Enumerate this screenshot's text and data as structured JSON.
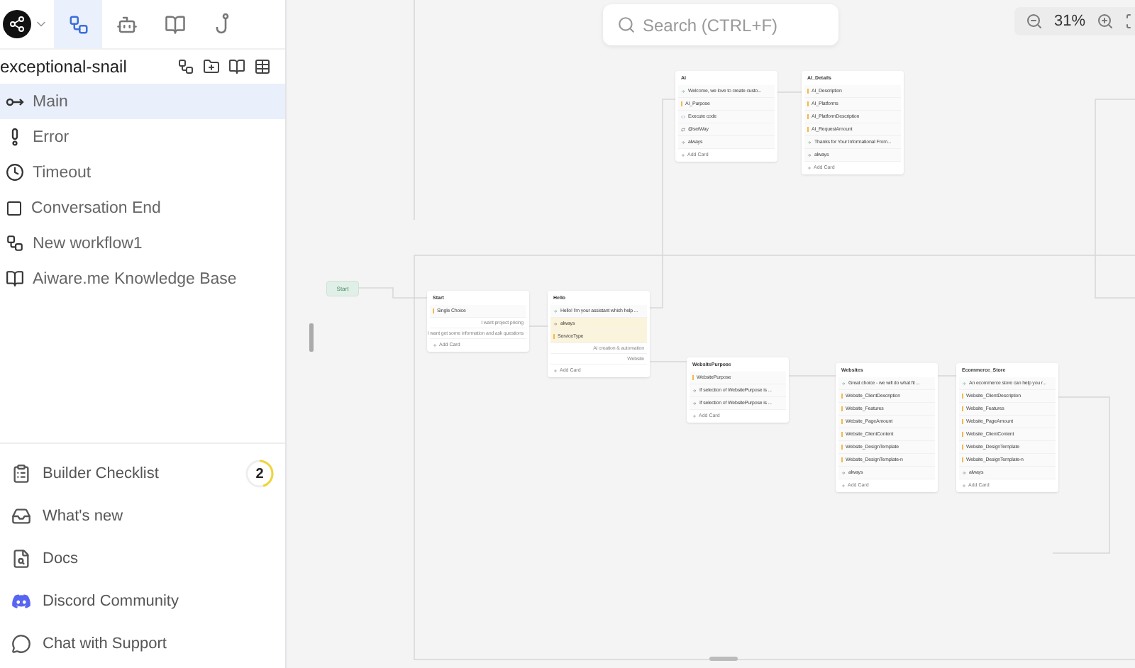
{
  "sidebar": {
    "tabs": [
      {
        "kind": "workflow",
        "selected": true
      },
      {
        "kind": "bot",
        "selected": false
      },
      {
        "kind": "book",
        "selected": false
      },
      {
        "kind": "hook",
        "selected": false
      }
    ]
  },
  "project": {
    "name": "exceptional-snail"
  },
  "workflows": [
    {
      "kind": "main",
      "label": "Main",
      "selected": true
    },
    {
      "kind": "error",
      "label": "Error",
      "selected": false
    },
    {
      "kind": "timeout",
      "label": "Timeout",
      "selected": false
    },
    {
      "kind": "end",
      "label": "Conversation End",
      "selected": false
    },
    {
      "kind": "workflow",
      "label": "New workflow1",
      "selected": false
    },
    {
      "kind": "knowledge",
      "label": "Aiware.me Knowledge Base",
      "selected": false
    }
  ],
  "footer_links": [
    {
      "kind": "checklist",
      "label": "Builder Checklist",
      "badge": "2",
      "level": 0.45
    },
    {
      "kind": "news",
      "label": "What's new"
    },
    {
      "kind": "docs",
      "label": "Docs"
    },
    {
      "kind": "discord",
      "label": "Discord Community"
    },
    {
      "kind": "support",
      "label": "Chat with Support"
    }
  ],
  "search": {
    "placeholder": "Search (CTRL+F)"
  },
  "zoom": {
    "value": "31%"
  },
  "canvas": {
    "start_label": "Start",
    "nodes": [
      {
        "title": "Start",
        "add_label": "Add Card",
        "rows": [
          {
            "kind": "input",
            "text": "Single Choice",
            "highlighted": false
          },
          {
            "kind": "option",
            "text": "I want project pricing",
            "highlighted": false
          },
          {
            "kind": "option",
            "text": "I want get some information and ask questions",
            "highlighted": false
          }
        ]
      },
      {
        "title": "Hello",
        "add_label": "Add Card",
        "rows": [
          {
            "kind": "message",
            "text": "Hello! I'm your assistant which help ...",
            "highlighted": false
          },
          {
            "kind": "always",
            "text": "always",
            "highlighted": true
          },
          {
            "kind": "input",
            "text": "ServiceType",
            "highlighted": true
          },
          {
            "kind": "option",
            "text": "AI creation & automation",
            "highlighted": false
          },
          {
            "kind": "option",
            "text": "Website",
            "highlighted": false
          }
        ]
      },
      {
        "title": "AI",
        "add_label": "Add Card",
        "rows": [
          {
            "kind": "message",
            "text": "Welcome, we love to create custo...",
            "highlighted": false
          },
          {
            "kind": "input",
            "text": "AI_Purpose",
            "highlighted": false
          },
          {
            "kind": "code",
            "text": "Execute code",
            "highlighted": false
          },
          {
            "kind": "action",
            "text": "@setWay",
            "highlighted": false
          },
          {
            "kind": "always",
            "text": "always",
            "highlighted": false
          }
        ]
      },
      {
        "title": "AI_Details",
        "add_label": "Add Card",
        "rows": [
          {
            "kind": "input",
            "text": "AI_Description",
            "highlighted": false
          },
          {
            "kind": "input",
            "text": "AI_Platforms",
            "highlighted": false
          },
          {
            "kind": "input",
            "text": "AI_PlatformDescription",
            "highlighted": false
          },
          {
            "kind": "input",
            "text": "AI_RequestAmount",
            "highlighted": false
          },
          {
            "kind": "message",
            "text": "Thanks for Your Informational From...",
            "highlighted": false
          },
          {
            "kind": "always",
            "text": "always",
            "highlighted": false
          }
        ]
      },
      {
        "title": "WebsitePurpose",
        "add_label": "Add Card",
        "rows": [
          {
            "kind": "input",
            "text": "WebsitePurpose",
            "highlighted": false
          },
          {
            "kind": "always",
            "text": "If selection of WebsitePurpose is ...",
            "highlighted": false
          },
          {
            "kind": "always",
            "text": "If selection of WebsitePurpose is ...",
            "highlighted": false
          }
        ]
      },
      {
        "title": "Websites",
        "add_label": "Add Card",
        "rows": [
          {
            "kind": "message",
            "text": "Great choice - we will do what fit ...",
            "highlighted": false
          },
          {
            "kind": "input",
            "text": "Website_ClientDescription",
            "highlighted": false
          },
          {
            "kind": "input",
            "text": "Website_Features",
            "highlighted": false
          },
          {
            "kind": "input",
            "text": "Website_PageAmount",
            "highlighted": false
          },
          {
            "kind": "input",
            "text": "Website_ClientContent",
            "highlighted": false
          },
          {
            "kind": "input",
            "text": "Website_DesignTemplate",
            "highlighted": false
          },
          {
            "kind": "input",
            "text": "Website_DesignTemplate-n",
            "highlighted": false
          },
          {
            "kind": "always",
            "text": "always",
            "highlighted": false
          }
        ]
      },
      {
        "title": "Ecommerce_Store",
        "add_label": "Add Card",
        "rows": [
          {
            "kind": "message",
            "text": "An ecommerce store can help you r...",
            "highlighted": false
          },
          {
            "kind": "input",
            "text": "Website_ClientDescription",
            "highlighted": false
          },
          {
            "kind": "input",
            "text": "Website_Features",
            "highlighted": false
          },
          {
            "kind": "input",
            "text": "Website_PageAmount",
            "highlighted": false
          },
          {
            "kind": "input",
            "text": "Website_ClientContent",
            "highlighted": false
          },
          {
            "kind": "input",
            "text": "Website_DesignTemplate",
            "highlighted": false
          },
          {
            "kind": "input",
            "text": "Website_DesignTemplate-n",
            "highlighted": false
          },
          {
            "kind": "always",
            "text": "always",
            "highlighted": false
          }
        ]
      }
    ]
  }
}
